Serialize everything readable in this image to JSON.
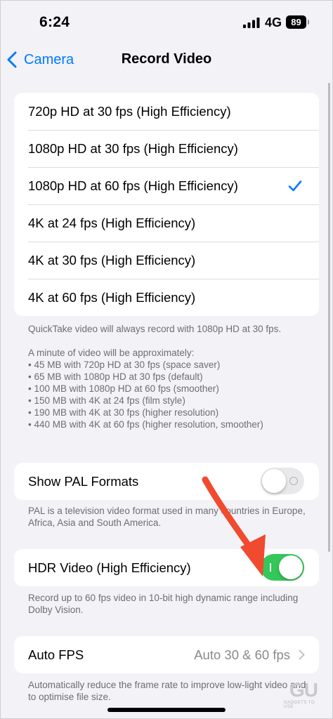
{
  "status_bar": {
    "time": "6:24",
    "network": "4G",
    "battery": "89"
  },
  "nav": {
    "back_label": "Camera",
    "title": "Record Video"
  },
  "resolution_options": [
    {
      "label": "720p HD at 30 fps (High Efficiency)",
      "selected": false
    },
    {
      "label": "1080p HD at 30 fps (High Efficiency)",
      "selected": false
    },
    {
      "label": "1080p HD at 60 fps (High Efficiency)",
      "selected": true
    },
    {
      "label": "4K at 24 fps (High Efficiency)",
      "selected": false
    },
    {
      "label": "4K at 30 fps (High Efficiency)",
      "selected": false
    },
    {
      "label": "4K at 60 fps (High Efficiency)",
      "selected": false
    }
  ],
  "quicktake_note": "QuickTake video will always record with 1080p HD at 30 fps.",
  "size_intro": "A minute of video will be approximately:",
  "size_list": [
    "45 MB with 720p HD at 30 fps (space saver)",
    "65 MB with 1080p HD at 30 fps (default)",
    "100 MB with 1080p HD at 60 fps (smoother)",
    "150 MB with 4K at 24 fps (film style)",
    "190 MB with 4K at 30 fps (higher resolution)",
    "440 MB with 4K at 60 fps (higher resolution, smoother)"
  ],
  "pal": {
    "label": "Show PAL Formats",
    "enabled": false,
    "footer": "PAL is a television video format used in many countries in Europe, Africa, Asia and South America."
  },
  "hdr": {
    "label": "HDR Video (High Efficiency)",
    "enabled": true,
    "footer": "Record up to 60 fps video in 10-bit high dynamic range including Dolby Vision."
  },
  "auto_fps": {
    "label": "Auto FPS",
    "value": "Auto 30 & 60 fps",
    "footer": "Automatically reduce the frame rate to improve low-light video and to optimise file size."
  },
  "watermark": {
    "logo": "GU",
    "text": "GADGETS TO USE"
  },
  "colors": {
    "accent": "#007aff",
    "toggle_on": "#34c759",
    "annotation_arrow": "#f04a2f",
    "background": "#f2f2f7"
  },
  "icons": {
    "back": "chevron-left-icon",
    "selected": "checkmark-icon",
    "disclosure": "chevron-right-icon",
    "signal": "cellular-signal-icon",
    "battery": "battery-icon"
  }
}
